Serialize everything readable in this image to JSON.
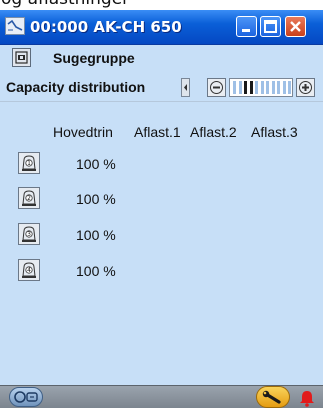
{
  "caption_fragment": "og aflastninger",
  "window": {
    "title": "00:000 AK-CH 650",
    "icons": {
      "app": "line-chart-icon",
      "minimize": "minimize-icon",
      "maximize": "maximize-icon",
      "close": "close-icon"
    }
  },
  "suction_group": {
    "label": "Sugegruppe",
    "icon": "suction-group-icon"
  },
  "capacity": {
    "label": "Capacity distribution",
    "minus_icon": "minus-icon",
    "plus_icon": "plus-icon",
    "left_scroll_icon": "scroll-left-icon",
    "level_fraction": 0.2
  },
  "columns": [
    "Hovedtrin",
    "Aflast.1",
    "Aflast.2",
    "Aflast.3"
  ],
  "compressors": [
    {
      "number": "1",
      "value": "100 %"
    },
    {
      "number": "2",
      "value": "100 %"
    },
    {
      "number": "3",
      "value": "100 %"
    },
    {
      "number": "4",
      "value": "100 %"
    }
  ],
  "bottom_bar": {
    "tool_icon": "controller-icon",
    "service_icon": "wrench-icon",
    "alarm_icon": "alarm-bell-icon",
    "alarm_color": "#e21b1b"
  },
  "colors": {
    "titlebar": "#0a5fd8",
    "background": "#c7dff7"
  }
}
